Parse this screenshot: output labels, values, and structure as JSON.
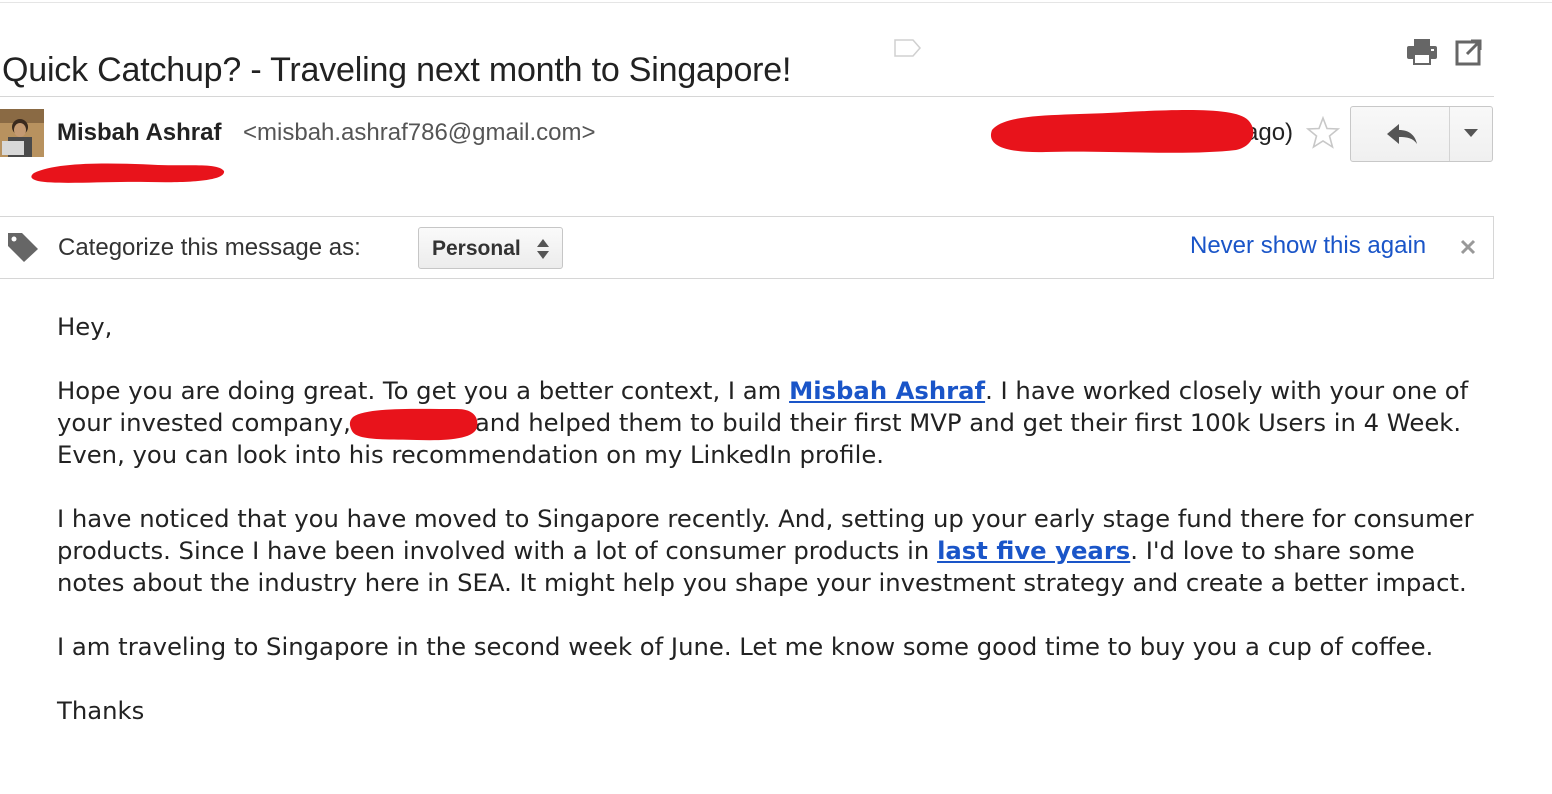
{
  "email": {
    "subject": "Quick Catchup? - Traveling next month to Singapore!",
    "sender": {
      "name": "Misbah Ashraf",
      "email": "<misbah.ashraf786@gmail.com>"
    },
    "date_visible": "ago)",
    "redaction_color": "#e8131b"
  },
  "categorize_bar": {
    "label": "Categorize this message as:",
    "selected_category": "Personal",
    "dismiss_link": "Never show this again",
    "dismiss_icon": "close-icon"
  },
  "body": {
    "greeting": "Hey,",
    "p1_a": "Hope you are doing great. To get you a better context, I am ",
    "p1_link": "Misbah Ashraf",
    "p1_b": ". I have worked closely with your one of your invested company,",
    "p1_c": "and helped them to build their first MVP and get their first 100k Users in 4 Week. Even, you can look into his recommendation on my LinkedIn profile.",
    "p2_a": "I have noticed that you have moved to Singapore recently. And, setting up your early stage fund there for consumer products. Since I have been involved with a lot of consumer products in ",
    "p2_link": "last five years",
    "p2_b": ". I'd love to share some notes about the industry here in SEA. It might help you shape your investment strategy and create a better impact.",
    "p3": "I am traveling to Singapore in the second week of June. Let me know some good time to buy you a cup of coffee.",
    "closing": "Thanks"
  },
  "colors": {
    "link": "#1a55c8",
    "text": "#222222"
  },
  "icons": [
    "label-icon",
    "print-icon",
    "new-window-icon",
    "star-icon",
    "reply-icon",
    "chevron-down-icon",
    "tag-icon",
    "close-icon"
  ]
}
